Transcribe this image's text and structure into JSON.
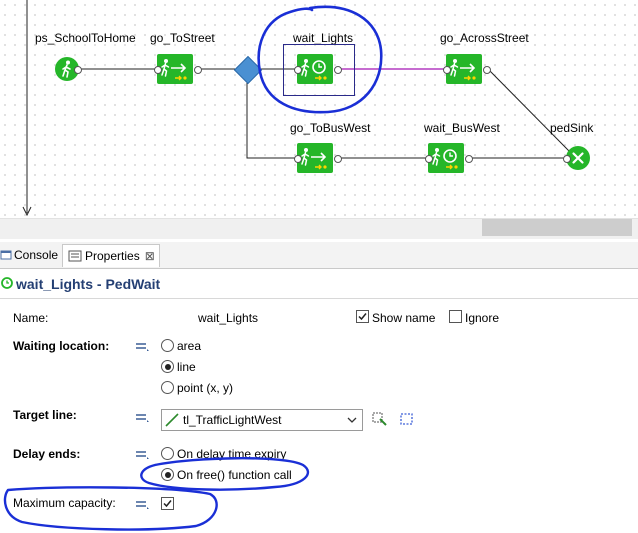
{
  "diagram": {
    "nodes": [
      {
        "id": "ps_SchoolToHome",
        "label": "ps_SchoolToHome",
        "kind": "source"
      },
      {
        "id": "go_ToStreet",
        "label": "go_ToStreet",
        "kind": "go"
      },
      {
        "id": "wait_Lights",
        "label": "wait_Lights",
        "kind": "wait"
      },
      {
        "id": "go_AcrossStreet",
        "label": "go_AcrossStreet",
        "kind": "go"
      },
      {
        "id": "go_ToBusWest",
        "label": "go_ToBusWest",
        "kind": "go"
      },
      {
        "id": "wait_BusWest",
        "label": "wait_BusWest",
        "kind": "wait"
      },
      {
        "id": "pedSink",
        "label": "pedSink",
        "kind": "sink"
      }
    ],
    "colors": {
      "block": "#25b629",
      "selected_link": "#b43cc0",
      "annotation": "#1a2fd6",
      "decision": "#4a90d2"
    }
  },
  "tabs": [
    {
      "label": "Console",
      "icon": "console-icon"
    },
    {
      "label": "Properties",
      "icon": "properties-icon",
      "close": "⊠"
    }
  ],
  "properties": {
    "title": "wait_Lights - PedWait",
    "name_label": "Name:",
    "name_value": "wait_Lights",
    "show_name_label": "Show name",
    "show_name_checked": true,
    "ignore_label": "Ignore",
    "ignore_checked": false,
    "waiting_location_label": "Waiting location:",
    "waiting_location_options": [
      "area",
      "line",
      "point (x, y)"
    ],
    "waiting_location_selected": "line",
    "target_line_label": "Target line:",
    "target_line_value": "tl_TrafficLightWest",
    "delay_ends_label": "Delay ends:",
    "delay_ends_options": [
      "On delay time expiry",
      "On free() function call"
    ],
    "delay_ends_selected": "On free() function call",
    "max_capacity_label": "Maximum capacity:",
    "max_capacity_checked": true
  }
}
